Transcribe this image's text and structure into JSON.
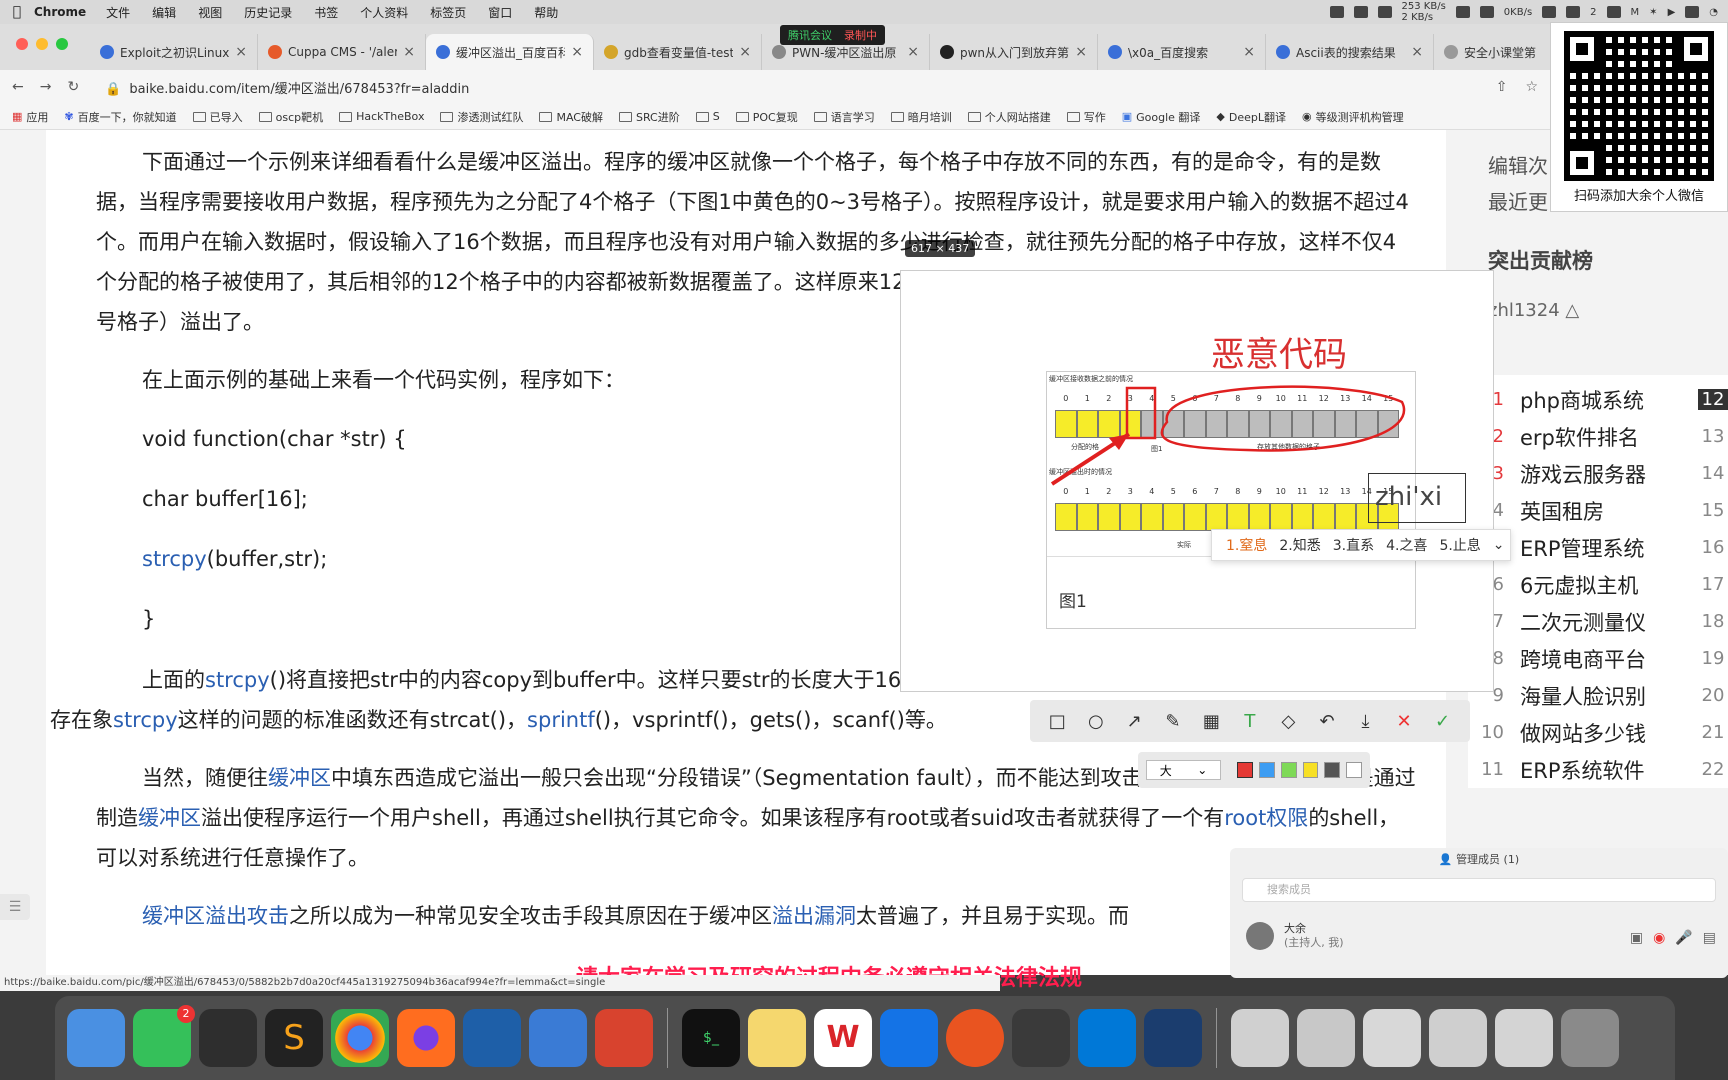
{
  "menubar": {
    "app": "Chrome",
    "items": [
      "文件",
      "编辑",
      "视图",
      "历史记录",
      "书签",
      "个人资料",
      "标签页",
      "窗口",
      "帮助"
    ],
    "net_up": "253 KB/s",
    "net_down": "2 KB/s",
    "disk": "0KB/s",
    "wechat_count": "2"
  },
  "tabs": [
    {
      "title": "Exploit之初识Linux",
      "active": false
    },
    {
      "title": "Cuppa CMS - '/alert",
      "active": false
    },
    {
      "title": "缓冲区溢出_百度百科",
      "active": true
    },
    {
      "title": "gdb查看变量值-test",
      "active": false
    },
    {
      "title": "PWN-缓冲区溢出原",
      "active": false
    },
    {
      "title": "pwn从入门到放弃第",
      "active": false
    },
    {
      "title": "\\x0a_百度搜索",
      "active": false
    },
    {
      "title": "Ascii表的搜索结果",
      "active": false
    },
    {
      "title": "安全小课堂第",
      "active": false
    }
  ],
  "meeting_overlay": {
    "label": "腾讯会议",
    "recording": "录制中"
  },
  "address": {
    "url": "baike.baidu.com/item/缓冲区溢出/678453?fr=aladdin"
  },
  "bookmarks": [
    "应用",
    "百度一下，你就知道",
    "已导入",
    "oscp靶机",
    "HackTheBox",
    "渗透测试红队",
    "MAC破解",
    "SRC进阶",
    "S",
    "POC复现",
    "语言学习",
    "暗月培训",
    "个人网站搭建",
    "写作",
    "Google 翻译",
    "DeepL翻译",
    "等级测评机构管理"
  ],
  "article": {
    "p1": "下面通过一个示例来详细看看什么是缓冲区溢出。程序的缓冲区就像一个个格子，每个格子中存放不同的东西，有的是命令，有的是数据，当程序需要接收用户数据，程序预先为之分配了4个格子（下图1中黄色的0~3号格子）。按照程序设计，就是要求用户输入的数据不超过4个。而用户在输入数据时，假设输入了16个数据，而且程序也没有对用户输入数据的多少进行检查，就往预先分配的格子中存放，这样不仅4个分配的格子被使用了，其后相邻的12个格子中的内容都被新数据覆盖了。这样原来12个格子中的内容就丢失了。这时就出现了缓冲区（0~3号格子）溢出了。",
    "p2": "在上面示例的基础上来看一个代码实例，程序如下：",
    "code1": "void function(char *str) {",
    "code2": "char buffer[16];",
    "code3_fn": "strcpy",
    "code3_rest": "(buffer,str);",
    "code4": "}",
    "p3_a": "上面的",
    "p3_link": "strcpy",
    "p3_b": "()将直接把str中的内容copy到buffer中。这样只要str的长度大于16，就会造",
    "p3_c": "存在象",
    "p3_link2": "strcpy",
    "p3_d": "这样的问题的标准函数还有strcat()，",
    "p3_link3": "sprintf",
    "p3_e": "()，vsprintf()，gets()，scanf()等。",
    "p4_a": "当然，随便往",
    "p4_link": "缓冲区",
    "p4_b": "中填东西造成它溢出一般只会出现“分段错误”（Segmentation fault），而不能达到攻击的目的。最常见的手段是通过制造",
    "p4_link2": "缓冲区",
    "p4_c": "溢出使程序运行一个用户shell，再通过shell执行其它命令。如果该程序有root或者suid",
    "p4_d": "攻击者就获得了一个有",
    "p4_link3": "root权限",
    "p4_e": "的shell，可以对系统进行任意操作了。",
    "p5_link": "缓冲区溢出攻击",
    "p5_a": "之所以成为一种常见安全攻击手段其原因在于缓冲区",
    "p5_link2": "溢出漏洞",
    "p5_b": "太普遍了，并且易于实现。而"
  },
  "sidebar": {
    "edit1": "编辑次",
    "edit2": "最近更",
    "contrib_title": "突出贡献榜",
    "user": "zhl1324",
    "hot": [
      {
        "num": "1",
        "text": "php商城系统",
        "rank": "12"
      },
      {
        "num": "2",
        "text": "erp软件排名",
        "rank": "13"
      },
      {
        "num": "3",
        "text": "游戏云服务器",
        "rank": "14"
      },
      {
        "num": "4",
        "text": "英国租房",
        "rank": "15"
      },
      {
        "num": "5",
        "text": "ERP管理系统",
        "rank": "16"
      },
      {
        "num": "6",
        "text": "6元虚拟主机",
        "rank": "17"
      },
      {
        "num": "7",
        "text": "二次元测量仪",
        "rank": "18"
      },
      {
        "num": "8",
        "text": "跨境电商平台",
        "rank": "19"
      },
      {
        "num": "9",
        "text": "海量人脸识别",
        "rank": "20"
      },
      {
        "num": "10",
        "text": "做网站多少钱",
        "rank": "21"
      },
      {
        "num": "11",
        "text": "ERP系统软件",
        "rank": "22"
      }
    ]
  },
  "qr": {
    "caption": "扫码添加大余个人微信"
  },
  "screenshot_tool": {
    "dimensions": "617 × 437",
    "annotation": "恶意代码",
    "fig_title1": "缓冲区接收数据之前的情况",
    "fig_title2": "缓冲区溢出时的情况",
    "alloc_label": "分配的格",
    "other_label": "存放其他数据的格子",
    "fig_small": "图1",
    "actual": "实际",
    "caption": "图1",
    "ime_text": "zhi'xi",
    "ime_candidates": [
      "1.窒息",
      "2.知悉",
      "3.直系",
      "4.之喜",
      "5.止息"
    ],
    "size_label": "大",
    "colors": [
      "#e53935",
      "#3d9df3",
      "#7ed957",
      "#f7e025",
      "#555555",
      "#ffffff"
    ]
  },
  "meeting": {
    "header": "管理成员 (1)",
    "search": "搜索成员",
    "member_name": "大余",
    "member_role": "(主持人, 我)"
  },
  "warning": "请大家在学习及研究的过程中务必遵守相关法律法规",
  "status_url": "https://baike.baidu.com/pic/缓冲区溢出/678453/0/5882b2b7d0a20cf445a1319275094b36acaf994e?fr=lemma&ct=single"
}
